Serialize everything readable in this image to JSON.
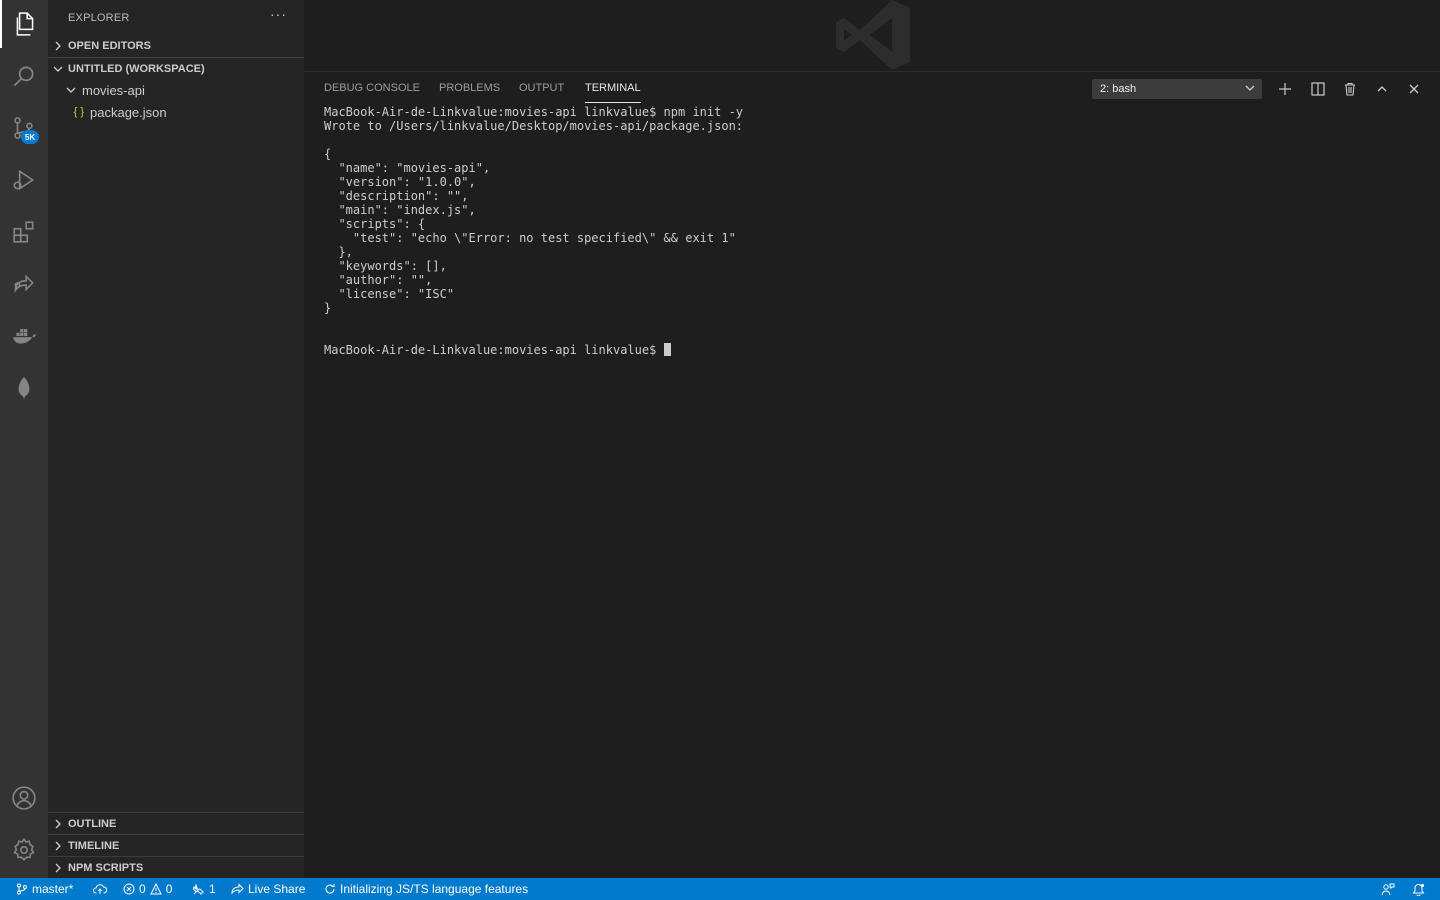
{
  "activity_bar": {
    "scm_badge": "5K"
  },
  "sidebar": {
    "title": "EXPLORER",
    "more_actions": "···",
    "open_editors_label": "OPEN EDITORS",
    "workspace_label": "UNTITLED (WORKSPACE)",
    "folder_name": "movies-api",
    "file_icon": "{ }",
    "file_name": "package.json",
    "outline_label": "OUTLINE",
    "timeline_label": "TIMELINE",
    "npm_scripts_label": "NPM SCRIPTS"
  },
  "panel": {
    "tabs": [
      {
        "label": "DEBUG CONSOLE",
        "active": false
      },
      {
        "label": "PROBLEMS",
        "active": false
      },
      {
        "label": "OUTPUT",
        "active": false
      },
      {
        "label": "TERMINAL",
        "active": true
      }
    ],
    "terminal_select": "2: bash",
    "terminal_lines": [
      "MacBook-Air-de-Linkvalue:movies-api linkvalue$ npm init -y",
      "Wrote to /Users/linkvalue/Desktop/movies-api/package.json:",
      "",
      "{",
      "  \"name\": \"movies-api\",",
      "  \"version\": \"1.0.0\",",
      "  \"description\": \"\",",
      "  \"main\": \"index.js\",",
      "  \"scripts\": {",
      "    \"test\": \"echo \\\"Error: no test specified\\\" && exit 1\"",
      "  },",
      "  \"keywords\": [],",
      "  \"author\": \"\",",
      "  \"license\": \"ISC\"",
      "}",
      "",
      ""
    ],
    "prompt": "MacBook-Air-de-Linkvalue:movies-api linkvalue$ "
  },
  "statusbar": {
    "branch": "master*",
    "errors": "0",
    "warnings": "0",
    "ports": "1",
    "live_share": "Live Share",
    "progress": "Initializing JS/TS language features"
  },
  "colors": {
    "statusbar": "#007acc",
    "activity_bar": "#333333",
    "sidebar": "#252526",
    "editor": "#1e1e1e"
  }
}
